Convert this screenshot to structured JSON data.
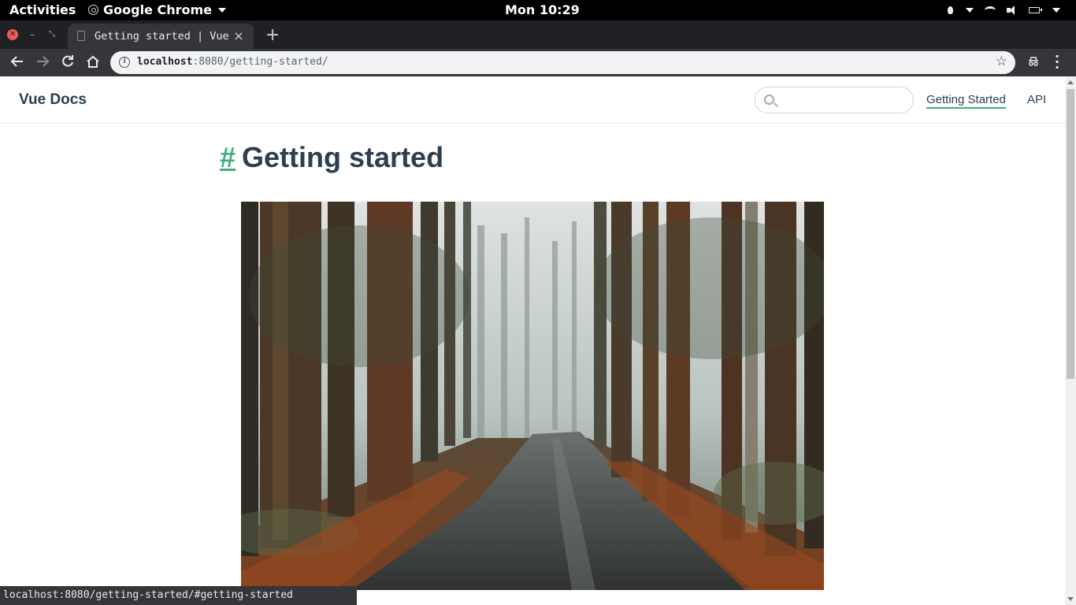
{
  "system_bar": {
    "activities": "Activities",
    "app_name": "Google Chrome",
    "clock": "Mon 10:29"
  },
  "browser": {
    "tab_title": "Getting started | Vue",
    "tab_close": "×",
    "new_tab": "+",
    "url_host": "localhost",
    "url_path": ":8080/getting-started/",
    "status_url": "localhost:8080/getting-started/#getting-started"
  },
  "site": {
    "title": "Vue Docs",
    "search_placeholder": "",
    "nav": {
      "getting_started": "Getting Started",
      "api": "API"
    },
    "heading_anchor": "#",
    "heading": "Getting started"
  },
  "icons": {
    "accent": "#3eaf7c",
    "text": "#2c3e50"
  }
}
